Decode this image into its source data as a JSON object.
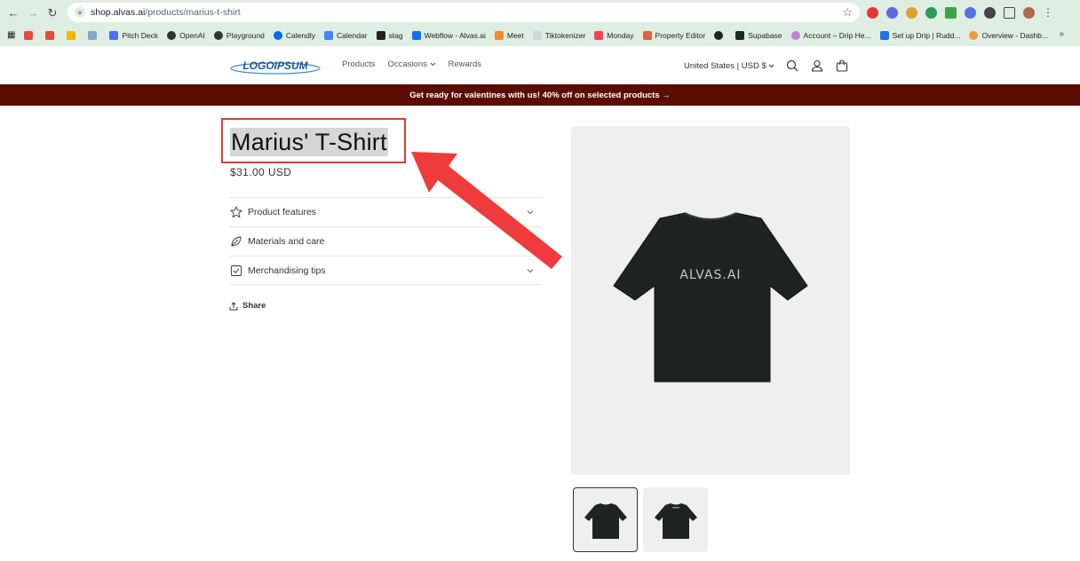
{
  "browser": {
    "url_host": "shop.alvas.ai",
    "url_path": "/products/marius-t-shirt",
    "bookmarks": [
      "Pitch Deck",
      "OpenAI",
      "Playground",
      "Calendly",
      "Calendar",
      "stag",
      "Webflow - Alvas.ai",
      "Meet",
      "Tiktokenizer",
      "Monday",
      "Property Editor",
      "Supabase",
      "Account – Drip He...",
      "Set up Drip | Rudd...",
      "Overview - Dashb..."
    ]
  },
  "header": {
    "logo_text": "LOGOIPSUM",
    "nav": [
      "Products",
      "Occasions",
      "Rewards"
    ],
    "locale": "United States | USD $"
  },
  "announcement": "Get ready for valentines with us! 40% off on selected products →",
  "product": {
    "title": "Marius' T-Shirt",
    "price": "$31.00 USD",
    "accordion": [
      "Product features",
      "Materials and care",
      "Merchandising tips"
    ],
    "share_label": "Share",
    "shirt_print": "ALVAS.AI"
  },
  "colors": {
    "announcement_bg": "#5c0d02",
    "highlight_box": "#e53935",
    "arrow": "#ef3b3b"
  }
}
